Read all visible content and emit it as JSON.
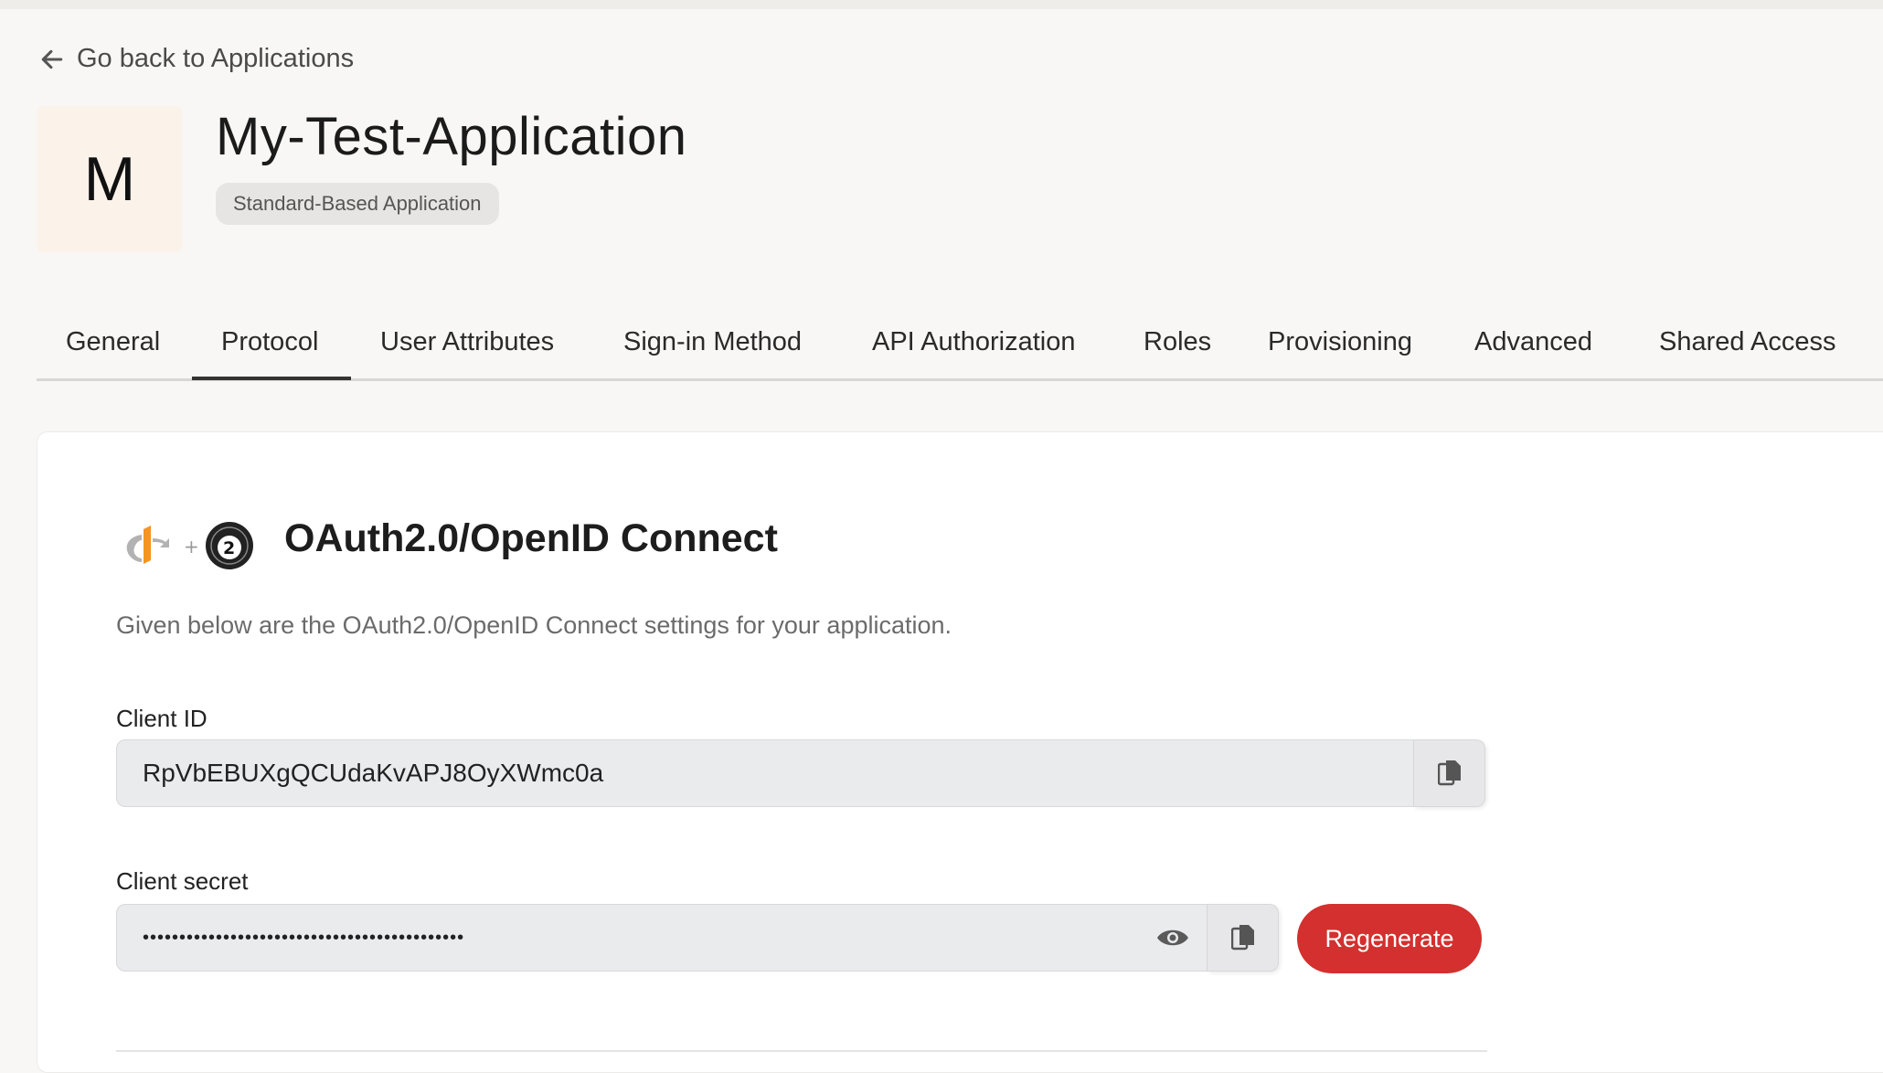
{
  "nav": {
    "back_label": "Go back to Applications"
  },
  "app": {
    "initial": "M",
    "name": "My-Test-Application",
    "type_badge": "Standard-Based Application"
  },
  "tabs": [
    {
      "label": "General"
    },
    {
      "label": "Protocol",
      "active": true
    },
    {
      "label": "User Attributes"
    },
    {
      "label": "Sign-in Method"
    },
    {
      "label": "API Authorization"
    },
    {
      "label": "Roles"
    },
    {
      "label": "Provisioning"
    },
    {
      "label": "Advanced"
    },
    {
      "label": "Shared Access"
    }
  ],
  "protocol": {
    "title": "OAuth2.0/OpenID Connect",
    "description": "Given below are the OAuth2.0/OpenID Connect settings for your application.",
    "client_id_label": "Client ID",
    "client_id_value": "RpVbEBUXgQCUdaKvAPJ8OyXWmc0a",
    "client_secret_label": "Client secret",
    "client_secret_masked": "••••••••••••••••••••••••••••••••••••••••••••",
    "regenerate_label": "Regenerate"
  },
  "icons": {
    "back": "arrow-left-icon",
    "copy": "copy-icon",
    "eye": "eye-icon",
    "protocol_logo": "openid-oauth2-logo-icon"
  },
  "colors": {
    "accent": "#d3302f",
    "active_tab": "#333333"
  }
}
